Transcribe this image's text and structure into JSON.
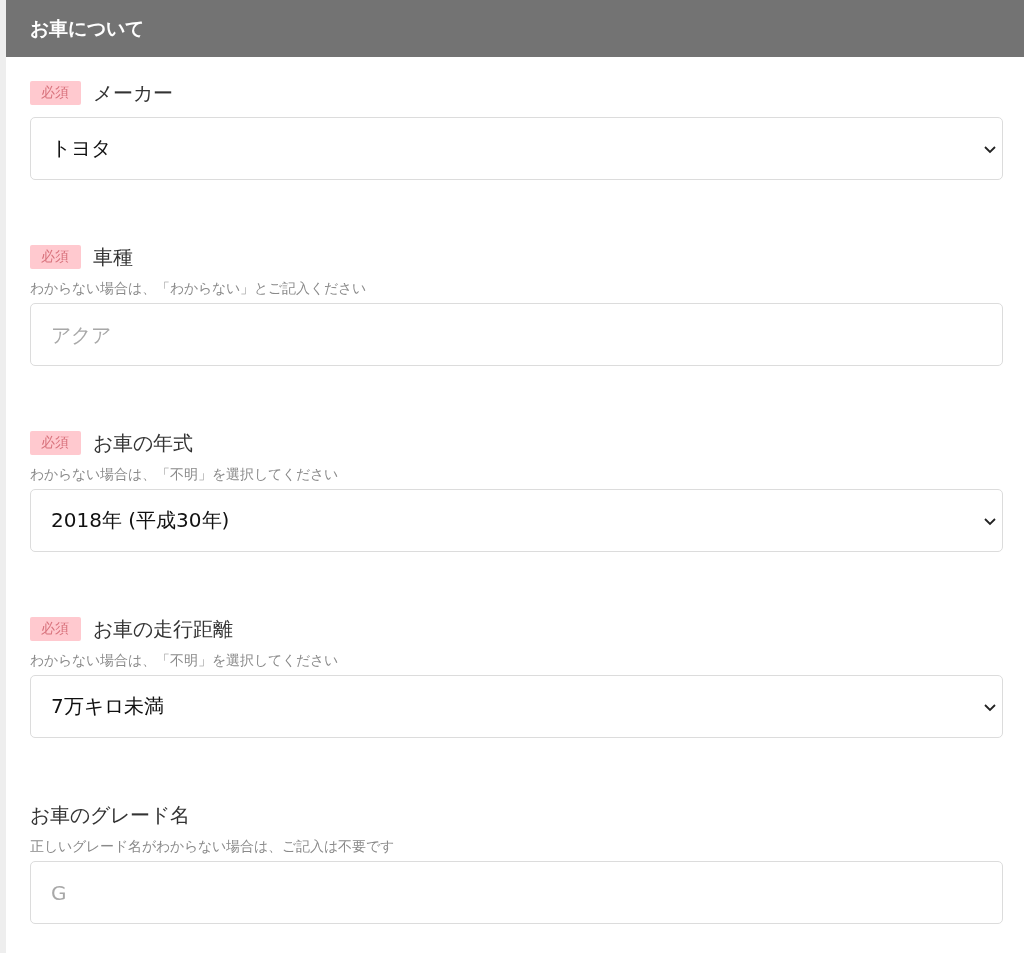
{
  "section": {
    "title": "お車について"
  },
  "fields": [
    {
      "kind": "select",
      "label": "メーカー",
      "required": true,
      "badge": "必須",
      "value": "トヨタ"
    },
    {
      "kind": "input",
      "label": "車種",
      "required": true,
      "badge": "必須",
      "hint": "わからない場合は、「わからない」とご記入ください",
      "placeholder": "アクア"
    },
    {
      "kind": "select",
      "label": "お車の年式",
      "required": true,
      "badge": "必須",
      "hint": "わからない場合は、「不明」を選択してください",
      "value": "2018年 (平成30年)"
    },
    {
      "kind": "select",
      "label": "お車の走行距離",
      "required": true,
      "badge": "必須",
      "hint": "わからない場合は、「不明」を選択してください",
      "value": "7万キロ未満"
    },
    {
      "kind": "input",
      "label": "お車のグレード名",
      "required": false,
      "hint": "正しいグレード名がわからない場合は、ご記入は不要です",
      "placeholder": "G"
    }
  ]
}
